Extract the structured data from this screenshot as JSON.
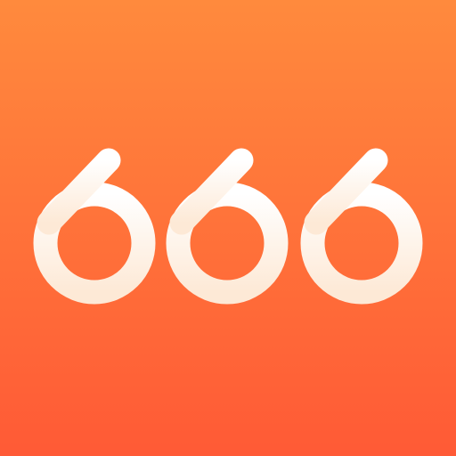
{
  "icon": {
    "logo_text": "666",
    "icon_name": "666-logo-icon",
    "colors": {
      "background_top": "#FF8A3D",
      "background_bottom": "#FF5A36",
      "glyph_top": "#FFFFFF",
      "glyph_bottom": "#FDE9D6"
    }
  }
}
